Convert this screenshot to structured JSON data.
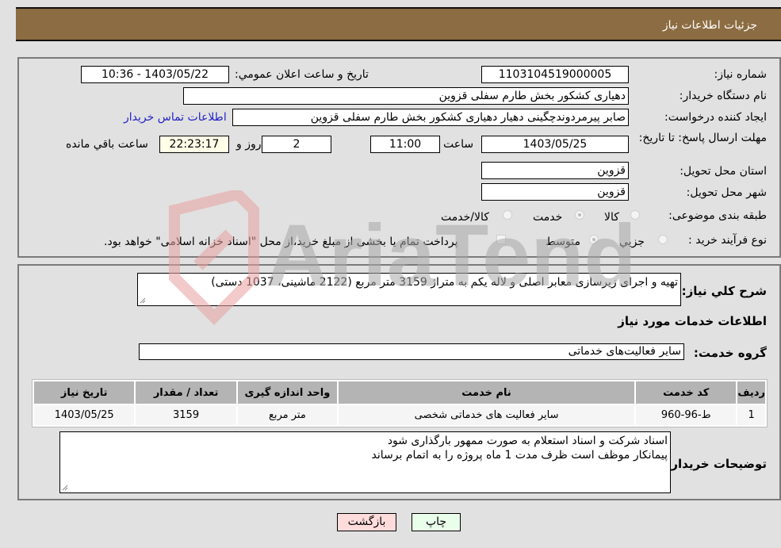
{
  "header": {
    "title": "جزئیات اطلاعات نیاز"
  },
  "form": {
    "need_number": {
      "label": "شماره نیاز:",
      "value": "1103104519000005"
    },
    "announce_datetime": {
      "label": "تاریخ و ساعت اعلان عمومي:",
      "value": "1403/05/22 - 10:36"
    },
    "buyer_org": {
      "label": "نام دستگاه خریدار:",
      "value": "دهیاری کشکور بخش طارم سفلی قزوین"
    },
    "requester": {
      "label": "ایجاد کننده درخواست:",
      "value": "صابر پیرمردوندچگینی دهیار دهیاری کشکور بخش طارم سفلی قزوین"
    },
    "contact_link": "اطلاعات تماس خریدار",
    "deadline": {
      "label": "مهلت ارسال پاسخ: تا تاریخ:",
      "date": "1403/05/25",
      "time_label": "ساعت",
      "time": "11:00",
      "days": "2",
      "days_label": "روز و",
      "remaining": "22:23:17",
      "remaining_label": "ساعت باقي مانده"
    },
    "province": {
      "label": "استان محل تحویل:",
      "value": "قزوین"
    },
    "city": {
      "label": "شهر محل تحویل:",
      "value": "قزوین"
    },
    "category": {
      "label": "طبقه بندی موضوعی:",
      "options": [
        {
          "label": "کالا",
          "selected": false
        },
        {
          "label": "خدمت",
          "selected": true
        },
        {
          "label": "کالا/خدمت",
          "selected": false
        }
      ]
    },
    "process": {
      "label": "نوع فرآیند خرید :",
      "options": [
        {
          "label": "جزيي",
          "selected": false
        },
        {
          "label": "متوسط",
          "selected": true
        }
      ],
      "treasury_note": "پرداخت تمام یا بخشی از مبلغ خرید،از محل \"اسناد خزانه اسلامی\" خواهد بود.",
      "treasury_checked": false
    }
  },
  "description": {
    "label": "شرح کلي نیاز:",
    "value": "تهیه و اجرای زیرسازی معابر اصلی و لاله یکم به متراژ 3159 متر مربع (2122 ماشینی، 1037 دستی)"
  },
  "services": {
    "section_title": "اطلاعات خدمات مورد نیاز",
    "group_label": "گروه خدمت:",
    "group_value": "سایر فعالیت‌های خدماتی",
    "table": {
      "headers": [
        "ردیف",
        "کد خدمت",
        "نام خدمت",
        "واحد اندازه گیری",
        "تعداد / مقدار",
        "تاریخ نیاز"
      ],
      "rows": [
        [
          "1",
          "ط-96-960",
          "سایر فعالیت های خدماتی شخصی",
          "متر مربع",
          "3159",
          "1403/05/25"
        ]
      ]
    }
  },
  "buyer_notes": {
    "label": "توضیحات خریدار:",
    "lines": [
      "اسناد شرکت و اسناد استعلام به صورت ممهور بارگذاری شود",
      "پیمانکار موظف است ظرف مدت 1 ماه پروژه را به اتمام برساند"
    ]
  },
  "buttons": {
    "print": "چاپ",
    "back": "بازگشت"
  },
  "watermark": "AriaTender.neT",
  "colors": {
    "header_bg": "#8c6c42",
    "print_bg": "#eaffea",
    "back_bg": "#ffdcdc",
    "link": "#2323c8"
  }
}
